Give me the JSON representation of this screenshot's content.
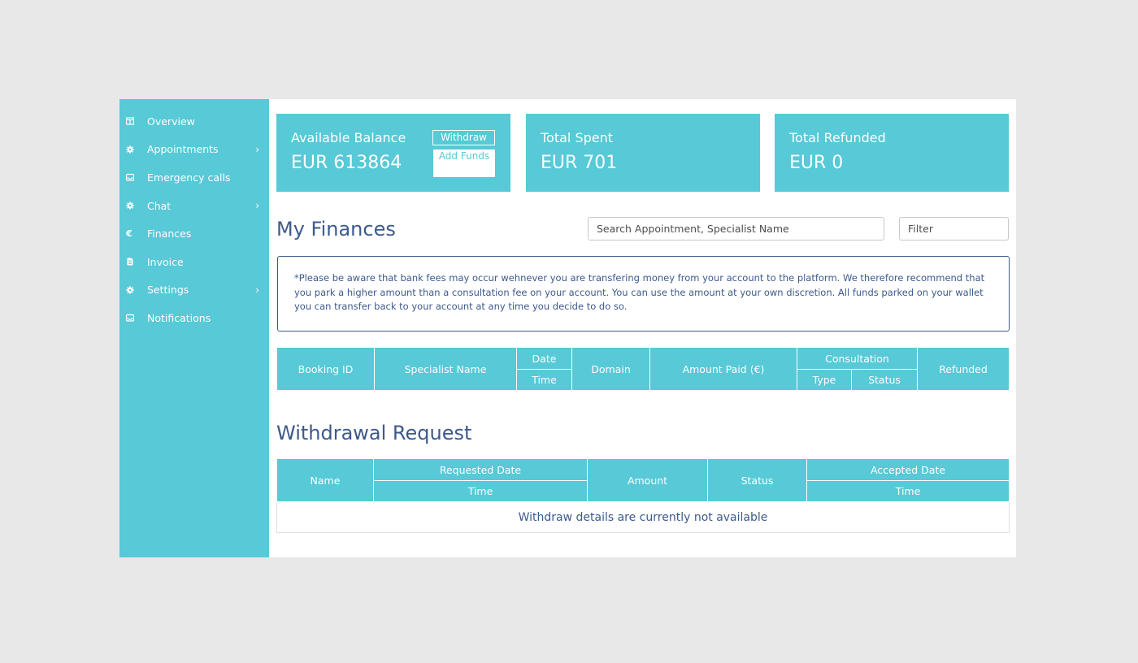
{
  "sidebar": {
    "items": [
      {
        "label": "Overview",
        "icon": "grid-icon",
        "chevron": ""
      },
      {
        "label": "Appointments",
        "icon": "gear-icon",
        "chevron": "›"
      },
      {
        "label": "Emergency calls",
        "icon": "inbox-icon",
        "chevron": ""
      },
      {
        "label": "Chat",
        "icon": "gear-icon",
        "chevron": "›"
      },
      {
        "label": "Finances",
        "icon": "euro-icon",
        "chevron": ""
      },
      {
        "label": "Invoice",
        "icon": "document-icon",
        "chevron": ""
      },
      {
        "label": "Settings",
        "icon": "gear-icon",
        "chevron": "›"
      },
      {
        "label": "Notifications",
        "icon": "inbox-icon",
        "chevron": ""
      }
    ]
  },
  "cards": {
    "balance": {
      "title": "Available Balance",
      "value": "EUR 613864",
      "withdraw_label": "Withdraw",
      "add_funds_label": "Add Funds"
    },
    "spent": {
      "title": "Total Spent",
      "value": "EUR 701"
    },
    "refunded": {
      "title": "Total Refunded",
      "value": "EUR 0"
    }
  },
  "finances": {
    "title": "My Finances",
    "search_placeholder": "Search Appointment, Specialist Name",
    "filter_placeholder": "Filter",
    "notice": "*Please be aware that bank fees may occur wehnever you are transfering money from your account to the platform. We therefore recommend that you park a higher amount than a consultation fee on your account. You can use the amount at your own discretion. All funds parked on your wallet you can transfer back to your account at any time you decide to do so.",
    "table": {
      "booking_id": "Booking ID",
      "specialist_name": "Specialist Name",
      "date": "Date",
      "time": "Time",
      "domain": "Domain",
      "amount_paid": "Amount Paid (€)",
      "consultation": "Consultation",
      "type": "Type",
      "status": "Status",
      "refunded": "Refunded"
    }
  },
  "withdrawal": {
    "title": "Withdrawal Request",
    "table": {
      "name": "Name",
      "requested_date": "Requested Date",
      "time": "Time",
      "amount": "Amount",
      "status": "Status",
      "accepted_date": "Accepted Date",
      "accepted_time": "Time"
    },
    "empty_message": "Withdraw details are currently not available"
  },
  "colors": {
    "accent": "#57c9d7",
    "heading": "#3d5a8c",
    "background": "#e8e8e8"
  }
}
